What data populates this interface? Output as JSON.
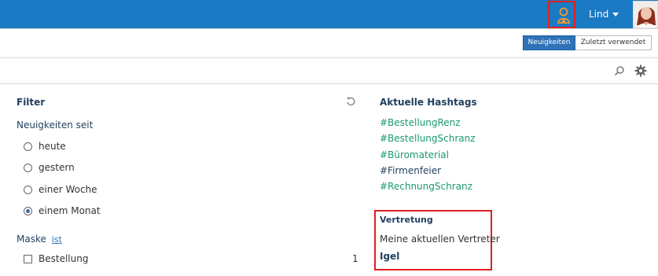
{
  "header": {
    "user_name": "Lind",
    "colors": {
      "bar": "#1a7ac4",
      "highlight": "#e02020"
    }
  },
  "tabs": [
    {
      "label": "Neuigkeiten",
      "active": true
    },
    {
      "label": "Zuletzt verwendet",
      "active": false
    }
  ],
  "toolbar": {
    "icons": [
      "search-icon",
      "gear-icon"
    ]
  },
  "filter": {
    "title": "Filter",
    "since_label": "Neuigkeiten seit",
    "options": [
      {
        "label": "heute",
        "checked": false
      },
      {
        "label": "gestern",
        "checked": false
      },
      {
        "label": "einer Woche",
        "checked": false
      },
      {
        "label": "einem Monat",
        "checked": true
      }
    ],
    "mask_label": "Maske",
    "mask_link": "ist",
    "mask_items": [
      {
        "label": "Bestellung",
        "count": "1"
      }
    ]
  },
  "hashtags": {
    "title": "Aktuelle Hashtags",
    "items": [
      {
        "label": "#BestellungRenz",
        "color": "#1a9a6a"
      },
      {
        "label": "#BestellungSchranz",
        "color": "#1a9a6a"
      },
      {
        "label": "#Büromaterial",
        "color": "#1a9a6a"
      },
      {
        "label": "#Firmenfeier",
        "color": "#1f3f5f"
      },
      {
        "label": "#RechnungSchranz",
        "color": "#1a9a6a"
      }
    ]
  },
  "deputy": {
    "title": "Vertretung",
    "subtitle": "Meine aktuellen Vertreter",
    "name": "Igel"
  }
}
